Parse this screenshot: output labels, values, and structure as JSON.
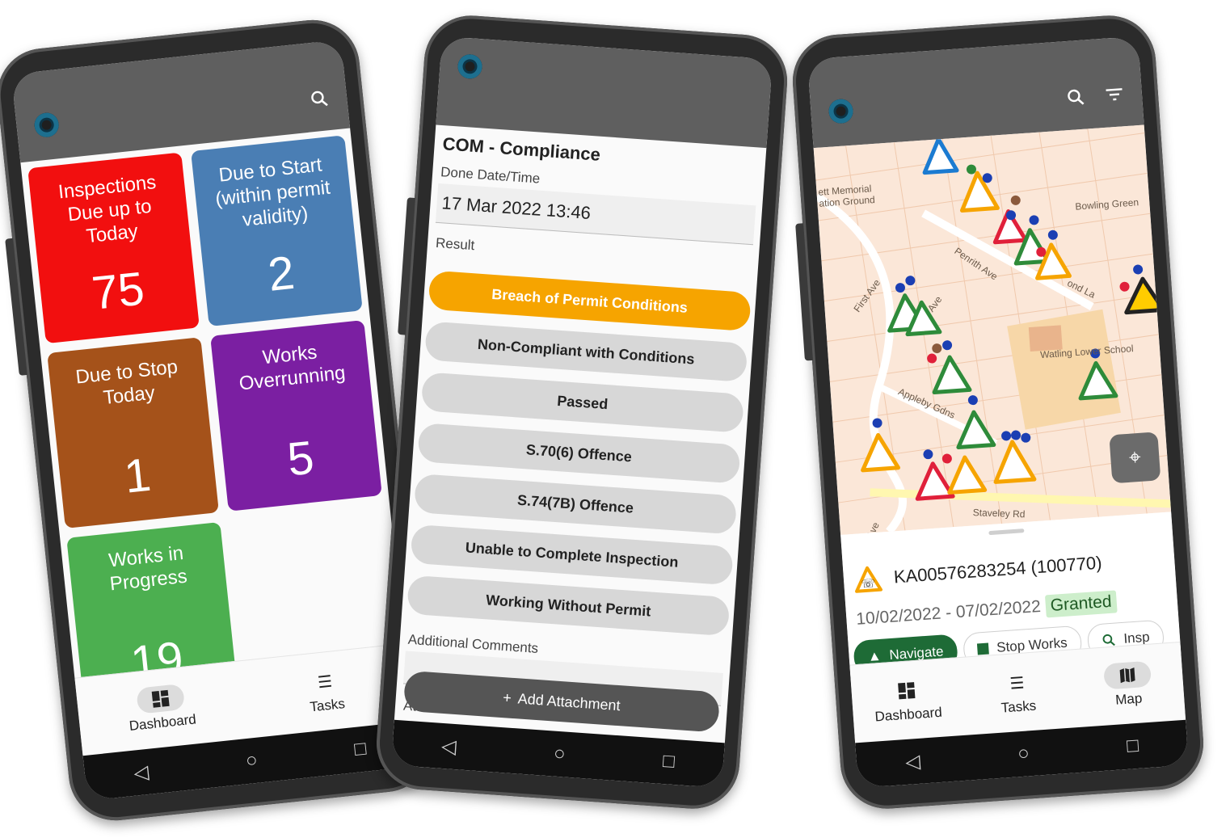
{
  "dashboard": {
    "tiles": [
      {
        "label": "Inspections Due up to Today",
        "count": "75",
        "color": "#f20f0f"
      },
      {
        "label": "Due to Start (within permit validity)",
        "count": "2",
        "color": "#4a7eb4"
      },
      {
        "label": "Due to Stop Today",
        "count": "1",
        "color": "#a5521a"
      },
      {
        "label": "Works Overrunning",
        "count": "5",
        "color": "#7b1fa2"
      },
      {
        "label": "Works in Progress",
        "count": "19",
        "color": "#4caf50"
      }
    ],
    "nav": [
      {
        "label": "Dashboard",
        "icon": "dashboard-icon",
        "active": true
      },
      {
        "label": "Tasks",
        "icon": "list-icon",
        "active": false
      }
    ]
  },
  "compliance": {
    "title": "COM - Compliance",
    "done_label": "Done Date/Time",
    "done_value": "17 Mar 2022 13:46",
    "result_label": "Result",
    "options": [
      "Breach of Permit Conditions",
      "Non-Compliant with Conditions",
      "Passed",
      "S.70(6) Offence",
      "S.74(7B) Offence",
      "Unable to Complete Inspection",
      "Working Without Permit"
    ],
    "selected_option": "Breach of Permit Conditions",
    "comments_label": "Additional Comments",
    "attachments_label": "Attachments",
    "add_attachment": "Add Attachment"
  },
  "map": {
    "labels": [
      "ett Memorial",
      "ation Ground",
      "Bowling Green",
      "Penrith Ave",
      "First Ave",
      "Ave",
      "Appleby Gdns",
      "Watling Lower School",
      "ond La",
      "Staveley Rd",
      "Ave"
    ],
    "work": {
      "reference": "KA00576283254 (100770)",
      "dates": "10/02/2022 - 07/02/2022",
      "status": "Granted",
      "status_color": "#cdeecb"
    },
    "actions": {
      "navigate": "Navigate",
      "stop_works": "Stop Works",
      "inspect": "Insp"
    },
    "nav": [
      {
        "label": "Dashboard",
        "icon": "dashboard-icon",
        "active": false
      },
      {
        "label": "Tasks",
        "icon": "list-icon",
        "active": false
      },
      {
        "label": "Map",
        "icon": "map-icon",
        "active": true
      }
    ]
  }
}
